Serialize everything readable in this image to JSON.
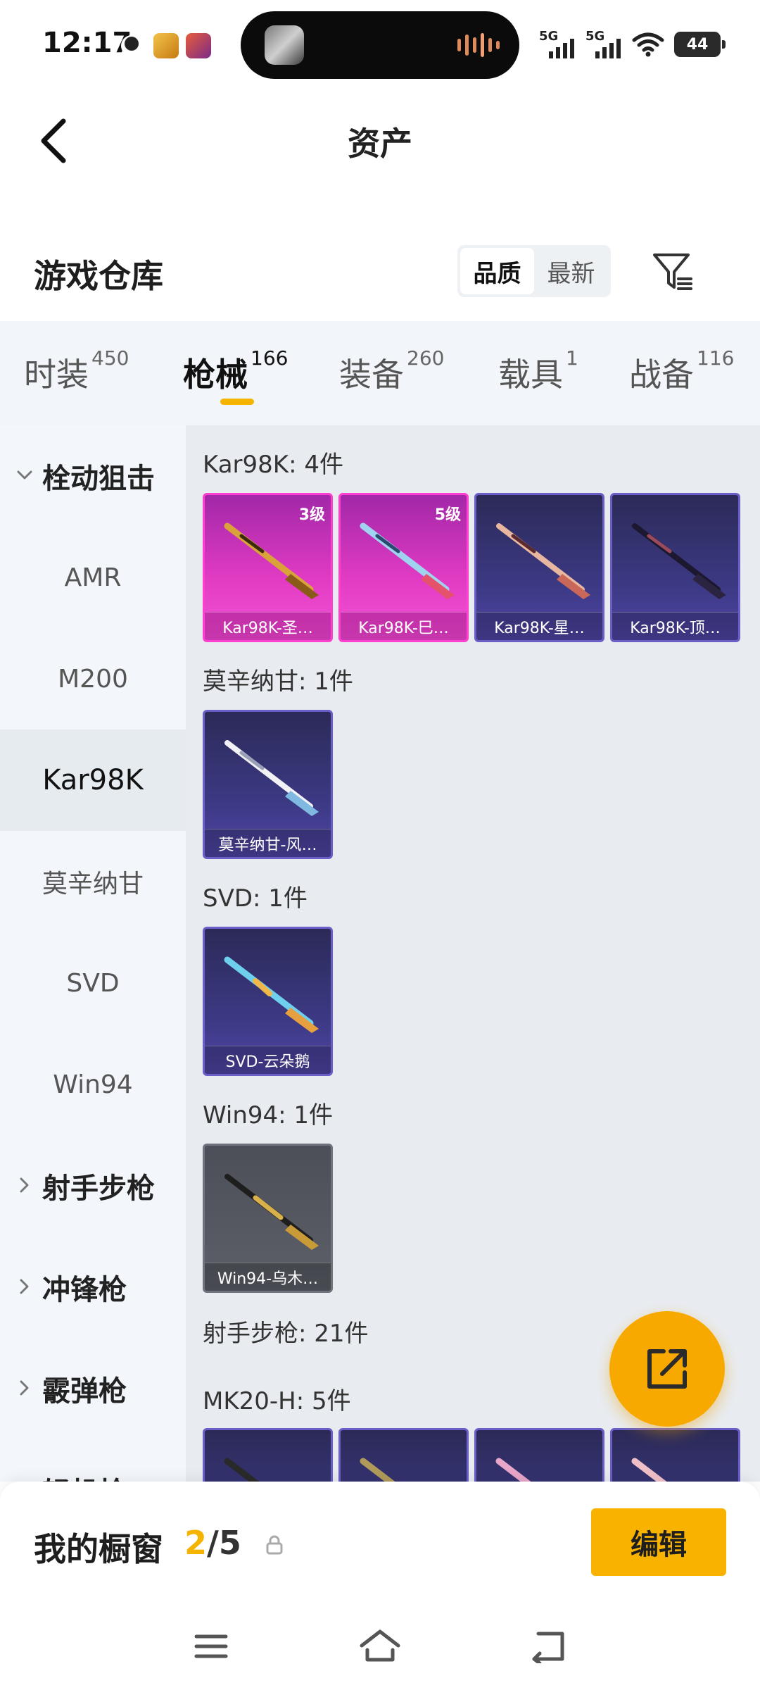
{
  "status_bar": {
    "time": "12:17",
    "signal_1": "5G",
    "signal_2": "5G",
    "battery": "44"
  },
  "header": {
    "title": "资产"
  },
  "warehouse": {
    "title": "游戏仓库",
    "sort_options": [
      "品质",
      "最新"
    ],
    "sort_selected": "品质"
  },
  "tabs": [
    {
      "label": "时装",
      "count": "450"
    },
    {
      "label": "枪械",
      "count": "166"
    },
    {
      "label": "装备",
      "count": "260"
    },
    {
      "label": "载具",
      "count": "1"
    },
    {
      "label": "战备",
      "count": "116"
    }
  ],
  "active_tab": "枪械",
  "categories": [
    {
      "label": "栓动狙击",
      "type": "group",
      "expanded": true
    },
    {
      "label": "AMR",
      "type": "sub"
    },
    {
      "label": "M200",
      "type": "sub"
    },
    {
      "label": "Kar98K",
      "type": "sub",
      "selected": true
    },
    {
      "label": "莫辛纳甘",
      "type": "sub"
    },
    {
      "label": "SVD",
      "type": "sub"
    },
    {
      "label": "Win94",
      "type": "sub"
    },
    {
      "label": "射手步枪",
      "type": "group",
      "expanded": false
    },
    {
      "label": "冲锋枪",
      "type": "group",
      "expanded": false
    },
    {
      "label": "霰弹枪",
      "type": "group",
      "expanded": false
    },
    {
      "label": "轻机枪",
      "type": "group",
      "expanded": false
    }
  ],
  "groups": [
    {
      "title": "Kar98K: 4件",
      "items": [
        {
          "name": "Kar98K-圣…",
          "level": "3级",
          "rarity": "pink"
        },
        {
          "name": "Kar98K-巳…",
          "level": "5级",
          "rarity": "pink"
        },
        {
          "name": "Kar98K-星…",
          "level": "",
          "rarity": "purple"
        },
        {
          "name": "Kar98K-顶…",
          "level": "",
          "rarity": "purple"
        }
      ]
    },
    {
      "title": "莫辛纳甘: 1件",
      "items": [
        {
          "name": "莫辛纳甘-风…",
          "level": "",
          "rarity": "purple"
        }
      ]
    },
    {
      "title": "SVD: 1件",
      "items": [
        {
          "name": "SVD-云朵鹅",
          "level": "",
          "rarity": "purple"
        }
      ]
    },
    {
      "title": "Win94: 1件",
      "items": [
        {
          "name": "Win94-乌木…",
          "level": "",
          "rarity": "gray"
        }
      ]
    }
  ],
  "section_title": "射手步枪: 21件",
  "sub_group_title": "MK20-H: 5件",
  "showcase": {
    "label": "我的橱窗",
    "current": "2",
    "total": "/5",
    "edit_label": "编辑"
  },
  "colors": {
    "accent": "#f7b300",
    "pink_rarity": "#e33cc4",
    "purple_rarity": "#3d3a86",
    "gray_rarity": "#5d6069"
  }
}
